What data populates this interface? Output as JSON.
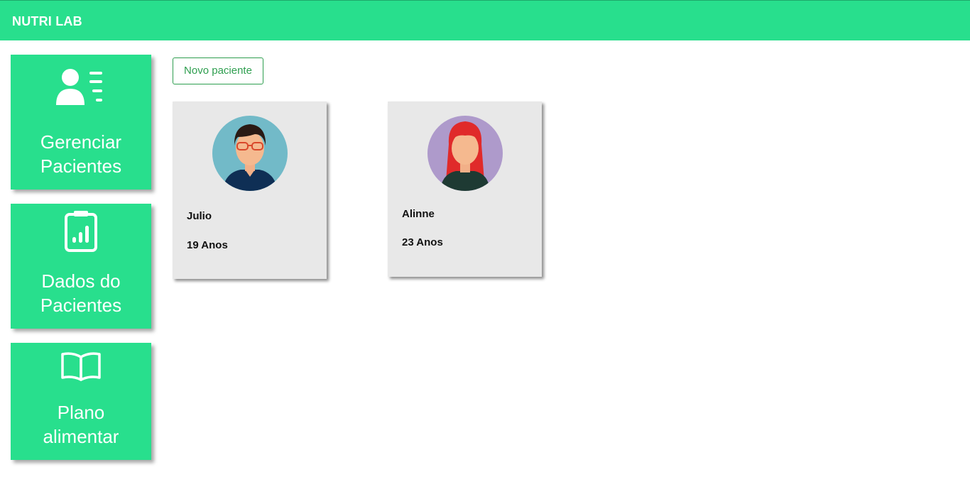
{
  "header": {
    "brand": "NUTRI LAB",
    "colors": {
      "accent": "#28df8d",
      "card_bg": "#e8e8e8",
      "button_border": "#2e9e4f"
    }
  },
  "sidebar": {
    "items": [
      {
        "label": "Gerenciar\nPacientes",
        "icon": "patient-list-icon"
      },
      {
        "label": "Dados do\nPacientes",
        "icon": "clipboard-chart-icon"
      },
      {
        "label": "Plano\nalimentar",
        "icon": "open-book-icon"
      }
    ]
  },
  "main": {
    "new_patient_label": "Novo paciente",
    "patients": [
      {
        "name": "Julio",
        "age": "19 Anos",
        "avatar": "male-avatar-icon"
      },
      {
        "name": "Alinne",
        "age": "23 Anos",
        "avatar": "female-avatar-icon"
      }
    ]
  }
}
